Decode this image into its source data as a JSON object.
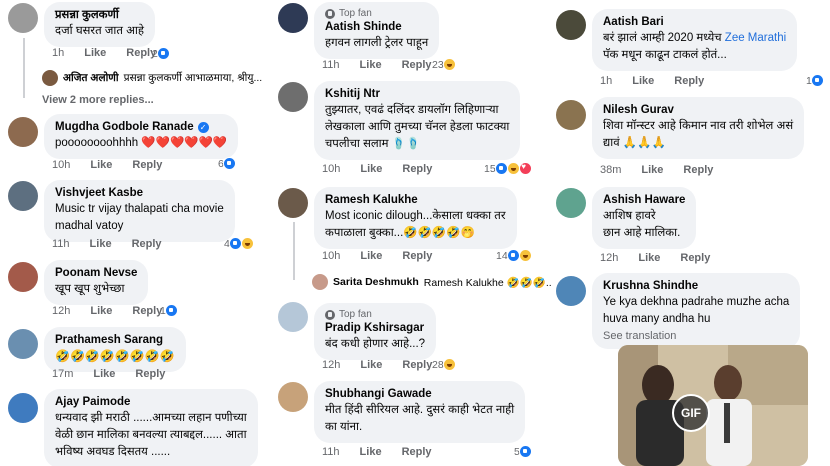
{
  "actions": {
    "like": "Like",
    "reply": "Reply"
  },
  "column1": {
    "comments": [
      {
        "name": "प्रसन्ना कुलकर्णी",
        "text": "दर्जा घसरत जात आहे",
        "time": "1h",
        "reaction_count": "2",
        "reply_preview": {
          "name": "अजित अलोणी",
          "text": "प्रसन्ना कुलकर्णी आभाळमाया, श्रीयु..."
        },
        "more_replies": "View 2 more replies..."
      },
      {
        "name": "Mugdha Godbole Ranade",
        "text": "poooooooohhhh ❤️❤️❤️❤️❤️❤️",
        "time": "10h",
        "reaction_count": "6"
      },
      {
        "name": "Vishvjeet Kasbe",
        "text": "Music tr vijay thalapati cha movie\nmadhal vatoy",
        "time": "11h",
        "reaction_count": "4"
      },
      {
        "name": "Poonam Nevse",
        "text": "खूप खूप शुभेच्छा",
        "time": "12h",
        "reaction_count": "1"
      },
      {
        "name": "Prathamesh Sarang",
        "text": "🤣🤣🤣🤣🤣🤣🤣🤣",
        "time": "17m"
      },
      {
        "name": "Ajay Paimode",
        "text": "धन्यवाद झी मराठी ......आमच्या लहान पणीच्या\nवेळी छान  मालिका बनवल्या त्याबद्दल...... आता\nभविष्य अवघड दिसतय ......"
      }
    ]
  },
  "column2": {
    "comments": [
      {
        "badge": "Top fan",
        "name": "Aatish Shinde",
        "text": "हगवन लागली ट्रेलर पाहून",
        "time": "11h",
        "reaction_count": "23"
      },
      {
        "name": "Kshitij Ntr",
        "text": "तुझ्यातर, एवढं दलिंदर डायलॉग लिहिणाऱ्या\nलेखकाला आणि तुमच्या चॅनल हेडला फाटक्या\nचपलीचा सलाम 🩴🩴",
        "time": "10h",
        "reaction_count": "15"
      },
      {
        "name": "Ramesh Kalukhe",
        "text": "Most iconic dilough...केसाला धक्का तर\nकपाळाला बुक्का...🤣🤣🤣🤣🤭",
        "time": "10h",
        "reaction_count": "14",
        "reply_preview": {
          "name": "Sarita Deshmukh",
          "text": "Ramesh Kalukhe 🤣🤣🤣..."
        }
      },
      {
        "badge": "Top fan",
        "name": "Pradip Kshirsagar",
        "text": "बंद कधी होणार आहे...?",
        "time": "12h",
        "reaction_count": "28"
      },
      {
        "name": "Shubhangi Gawade",
        "text": "मीत हिंदी सीरियल आहे. दुसरं काही भेटत नाही\nका यांना.",
        "time": "11h",
        "reaction_count": "5"
      }
    ]
  },
  "column3": {
    "comments": [
      {
        "name": "Aatish Bari",
        "text_before": "बरं झालं आम्ही 2020 मध्येच ",
        "text_link": "Zee Marathi",
        "text_after": "\nपॅक मधून काढून टाकलं होतं...",
        "time": "1h",
        "reaction_count": "1"
      },
      {
        "name": "Nilesh Gurav",
        "text": "शिवा मॉन्स्टर आहे किमान नाव तरी शोभेल असं\nद्यावं 🙏🙏🙏",
        "time": "38m"
      },
      {
        "name": "Ashish Haware",
        "text": "आशिष हावरे\nछान आहे मालिका.",
        "time": "12h"
      },
      {
        "name": "Krushna Shindhe",
        "text": "Ye kya dekhna padrahe muzhe acha\nhuva many andha hu",
        "see_translation": "See translation",
        "gif_label": "GIF"
      }
    ]
  },
  "colors": {
    "bubble": "#f0f2f5",
    "meta": "#65676b",
    "link": "#216fdb",
    "like": "#1877f2",
    "love": "#f33e58",
    "haha": "#f7c13b"
  }
}
